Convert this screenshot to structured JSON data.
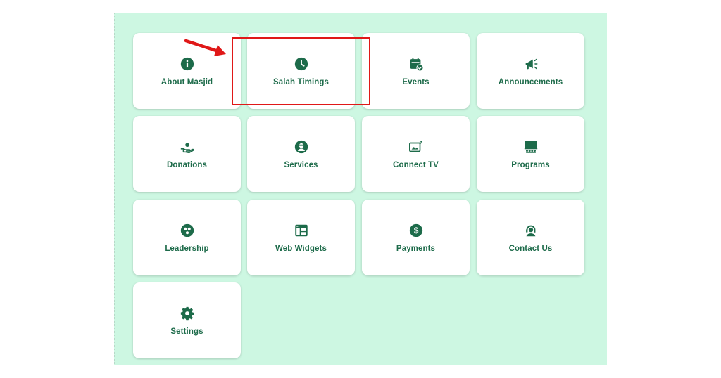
{
  "tiles": [
    {
      "label": "About Masjid",
      "icon": "info-icon"
    },
    {
      "label": "Salah Timings",
      "icon": "clock-icon"
    },
    {
      "label": "Events",
      "icon": "calendar-check-icon"
    },
    {
      "label": "Announcements",
      "icon": "megaphone-icon"
    },
    {
      "label": "Donations",
      "icon": "hand-donation-icon"
    },
    {
      "label": "Services",
      "icon": "person-badge-icon"
    },
    {
      "label": "Connect TV",
      "icon": "tv-cast-icon"
    },
    {
      "label": "Programs",
      "icon": "presentation-icon"
    },
    {
      "label": "Leadership",
      "icon": "group-icon"
    },
    {
      "label": "Web Widgets",
      "icon": "browser-window-icon"
    },
    {
      "label": "Payments",
      "icon": "dollar-icon"
    },
    {
      "label": "Contact Us",
      "icon": "support-agent-icon"
    },
    {
      "label": "Settings",
      "icon": "gear-icon"
    }
  ],
  "colors": {
    "background": "#cdf7e2",
    "tile": "#ffffff",
    "accent": "#1d6b4a",
    "annotation": "#e01818"
  }
}
